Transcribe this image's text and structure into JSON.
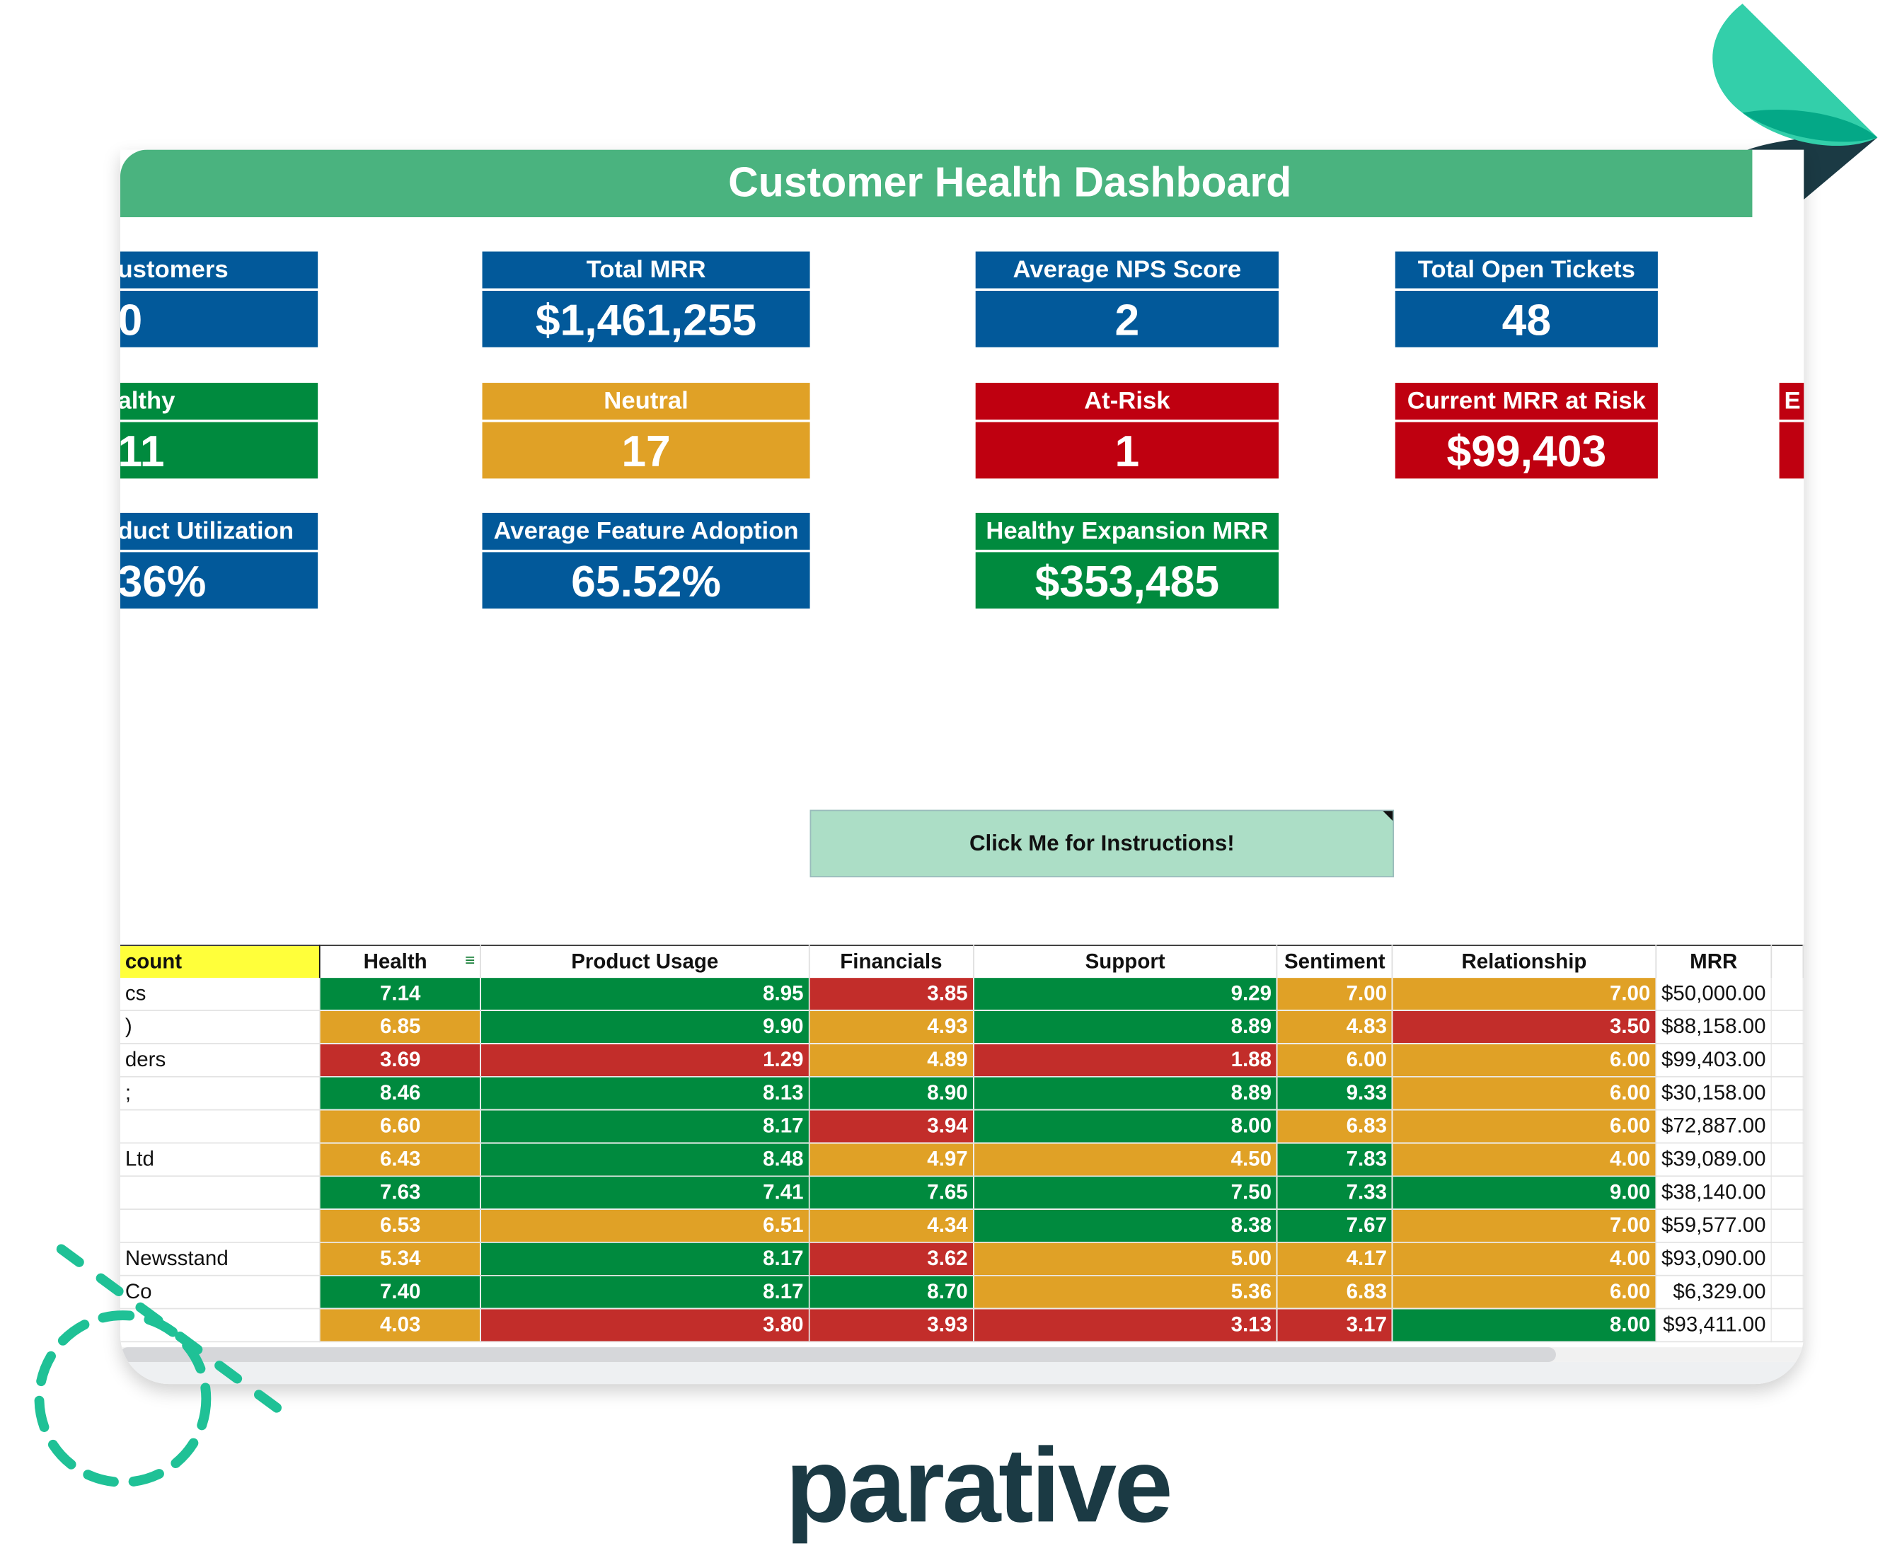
{
  "title": "Customer Health Dashboard",
  "colors": {
    "header": "#4ab37f",
    "blue": "#02599a",
    "green": "#008a3e",
    "orange": "#e0a126",
    "red": "#bf0010",
    "table_red": "#c22d2a",
    "button": "#acdec6",
    "brand_dark": "#1b3a44",
    "brand_teal": "#33cfaa"
  },
  "cards": [
    {
      "title": "ustomers",
      "value": "0",
      "color": "blue"
    },
    {
      "title": "Total MRR",
      "value": "$1,461,255",
      "color": "blue"
    },
    {
      "title": "Average NPS Score",
      "value": "2",
      "color": "blue"
    },
    {
      "title": "Total Open Tickets",
      "value": "48",
      "color": "blue"
    },
    {
      "title": "althy",
      "value": "11",
      "color": "green"
    },
    {
      "title": "Neutral",
      "value": "17",
      "color": "orange"
    },
    {
      "title": "At-Risk",
      "value": "1",
      "color": "red"
    },
    {
      "title": "Current MRR at Risk",
      "value": "$99,403",
      "color": "red"
    },
    {
      "title": "E",
      "value": "",
      "color": "red"
    },
    {
      "title": "duct Utilization",
      "value": "36%",
      "color": "blue"
    },
    {
      "title": "Average Feature Adoption",
      "value": "65.52%",
      "color": "blue"
    },
    {
      "title": "Healthy Expansion MRR",
      "value": "$353,485",
      "color": "green"
    }
  ],
  "instructions_button": "Click Me for Instructions!",
  "table": {
    "headers": [
      "count",
      "Health",
      "Product Usage",
      "Financials",
      "Support",
      "Sentiment",
      "Relationship",
      "MRR"
    ],
    "rows": [
      {
        "account": "cs",
        "cells": [
          [
            "7.14",
            "g"
          ],
          [
            "8.95",
            "g"
          ],
          [
            "3.85",
            "r"
          ],
          [
            "9.29",
            "g"
          ],
          [
            "7.00",
            "o"
          ],
          [
            "7.00",
            "o"
          ]
        ],
        "mrr": "$50,000.00"
      },
      {
        "account": ")",
        "cells": [
          [
            "6.85",
            "o"
          ],
          [
            "9.90",
            "g"
          ],
          [
            "4.93",
            "o"
          ],
          [
            "8.89",
            "g"
          ],
          [
            "4.83",
            "o"
          ],
          [
            "3.50",
            "r"
          ]
        ],
        "mrr": "$88,158.00"
      },
      {
        "account": "ders",
        "cells": [
          [
            "3.69",
            "r"
          ],
          [
            "1.29",
            "r"
          ],
          [
            "4.89",
            "o"
          ],
          [
            "1.88",
            "r"
          ],
          [
            "6.00",
            "o"
          ],
          [
            "6.00",
            "o"
          ]
        ],
        "mrr": "$99,403.00"
      },
      {
        "account": ";",
        "cells": [
          [
            "8.46",
            "g"
          ],
          [
            "8.13",
            "g"
          ],
          [
            "8.90",
            "g"
          ],
          [
            "8.89",
            "g"
          ],
          [
            "9.33",
            "g"
          ],
          [
            "6.00",
            "o"
          ]
        ],
        "mrr": "$30,158.00"
      },
      {
        "account": "",
        "cells": [
          [
            "6.60",
            "o"
          ],
          [
            "8.17",
            "g"
          ],
          [
            "3.94",
            "r"
          ],
          [
            "8.00",
            "g"
          ],
          [
            "6.83",
            "o"
          ],
          [
            "6.00",
            "o"
          ]
        ],
        "mrr": "$72,887.00"
      },
      {
        "account": " Ltd",
        "cells": [
          [
            "6.43",
            "o"
          ],
          [
            "8.48",
            "g"
          ],
          [
            "4.97",
            "o"
          ],
          [
            "4.50",
            "o"
          ],
          [
            "7.83",
            "g"
          ],
          [
            "4.00",
            "o"
          ]
        ],
        "mrr": "$39,089.00"
      },
      {
        "account": "",
        "cells": [
          [
            "7.63",
            "g"
          ],
          [
            "7.41",
            "g"
          ],
          [
            "7.65",
            "g"
          ],
          [
            "7.50",
            "g"
          ],
          [
            "7.33",
            "g"
          ],
          [
            "9.00",
            "g"
          ]
        ],
        "mrr": "$38,140.00"
      },
      {
        "account": "",
        "cells": [
          [
            "6.53",
            "o"
          ],
          [
            "6.51",
            "o"
          ],
          [
            "4.34",
            "o"
          ],
          [
            "8.38",
            "g"
          ],
          [
            "7.67",
            "g"
          ],
          [
            "7.00",
            "o"
          ]
        ],
        "mrr": "$59,577.00"
      },
      {
        "account": " Newsstand",
        "cells": [
          [
            "5.34",
            "o"
          ],
          [
            "8.17",
            "g"
          ],
          [
            "3.62",
            "r"
          ],
          [
            "5.00",
            "o"
          ],
          [
            "4.17",
            "o"
          ],
          [
            "4.00",
            "o"
          ]
        ],
        "mrr": "$93,090.00"
      },
      {
        "account": "Co",
        "cells": [
          [
            "7.40",
            "g"
          ],
          [
            "8.17",
            "g"
          ],
          [
            "8.70",
            "g"
          ],
          [
            "5.36",
            "o"
          ],
          [
            "6.83",
            "o"
          ],
          [
            "6.00",
            "o"
          ]
        ],
        "mrr": "$6,329.00"
      },
      {
        "account": "",
        "cells": [
          [
            "4.03",
            "o"
          ],
          [
            "3.80",
            "r"
          ],
          [
            "3.93",
            "r"
          ],
          [
            "3.13",
            "r"
          ],
          [
            "3.17",
            "r"
          ],
          [
            "8.00",
            "g"
          ]
        ],
        "mrr": "$93,411.00"
      }
    ]
  },
  "brand": "parative"
}
